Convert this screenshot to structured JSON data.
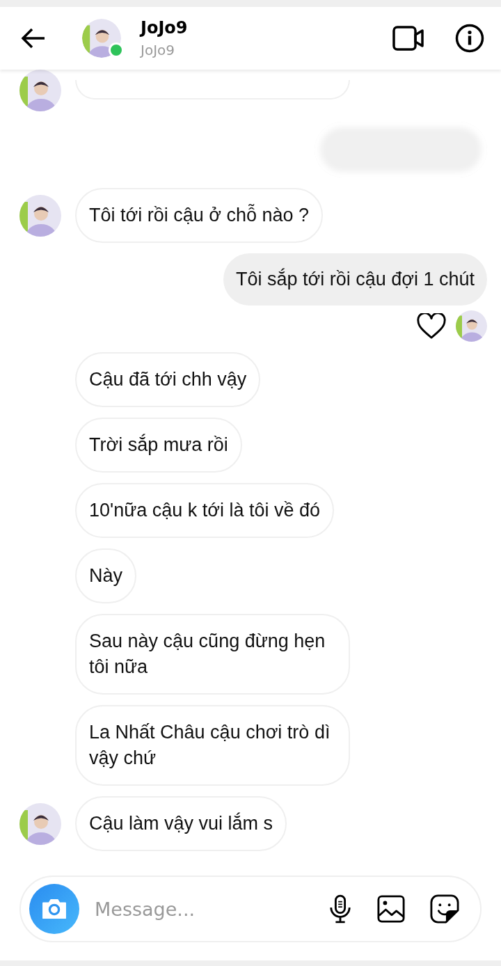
{
  "header": {
    "name": "JoJo9",
    "username": "JoJo9",
    "online": true
  },
  "messages": [
    {
      "kind": "incoming",
      "avatar": true,
      "cut": true
    },
    {
      "kind": "outgoing",
      "blurred": true
    },
    {
      "kind": "incoming",
      "avatar": true,
      "text": "Tôi tới rồi cậu ở chỗ nào ?"
    },
    {
      "kind": "outgoing",
      "text": "Tôi sắp tới rồi cậu đợi 1 chút",
      "seen": true
    },
    {
      "kind": "incoming",
      "avatar": false,
      "text": "Cậu đã tới chh vậy"
    },
    {
      "kind": "incoming",
      "avatar": false,
      "text": "Trời sắp mưa rồi"
    },
    {
      "kind": "incoming",
      "avatar": false,
      "text": "10'nữa cậu k tới là tôi về đó"
    },
    {
      "kind": "incoming",
      "avatar": false,
      "text": "Này"
    },
    {
      "kind": "incoming",
      "avatar": false,
      "text": "Sau này cậu cũng đừng hẹn tôi nữa"
    },
    {
      "kind": "incoming",
      "avatar": false,
      "text": "La Nhất Châu cậu chơi trò dì vậy chứ"
    },
    {
      "kind": "incoming",
      "avatar": true,
      "text": "Cậu làm vậy vui lắm s"
    }
  ],
  "composer": {
    "placeholder": "Message..."
  }
}
